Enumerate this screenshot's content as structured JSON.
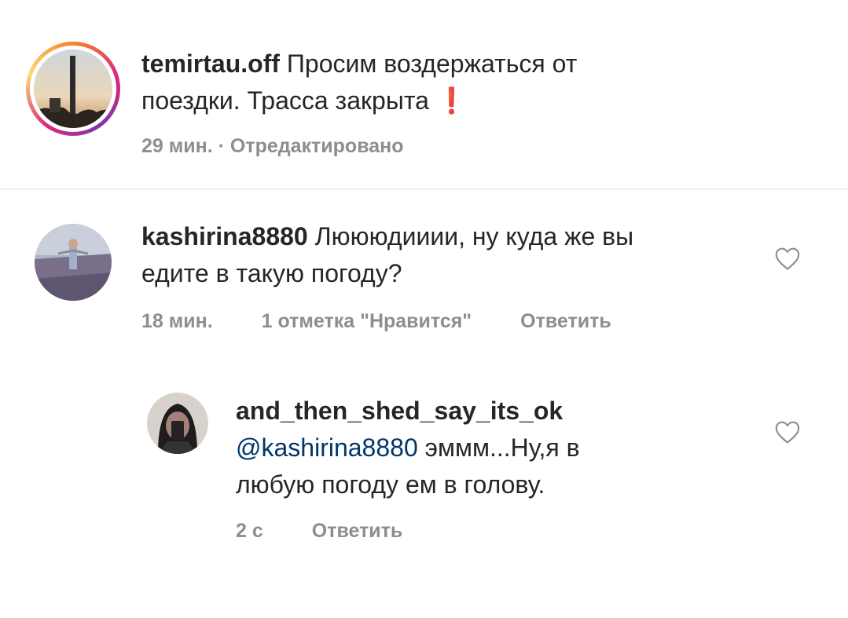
{
  "post": {
    "username": "temirtau.off",
    "caption_line1": "Просим воздержаться от",
    "caption_line2": "поездки. Трасса закрыта",
    "exclaim": "❗",
    "time": "29 мин.",
    "separator": " · ",
    "edited": "Отредактировано"
  },
  "comments": [
    {
      "username": "kashirina8880",
      "text_line1": "Люююдииии, ну куда же вы",
      "text_line2": "едите в такую погоду?",
      "time": "18 мин.",
      "likes": "1 отметка \"Нравится\"",
      "reply": "Ответить",
      "like_icon": "heart-outline"
    },
    {
      "username": "and_then_shed_say_its_ok",
      "mention": "@kashirina8880",
      "text_line1": " эммм...Ну,я в",
      "text_line2": "любую погоду ем в голову.",
      "time": "2 с",
      "reply": "Ответить",
      "like_icon": "heart-outline"
    }
  ],
  "colors": {
    "text": "#262626",
    "meta": "#8e8e8e",
    "mention": "#00376b",
    "story_ring": "#dd2a7b"
  }
}
